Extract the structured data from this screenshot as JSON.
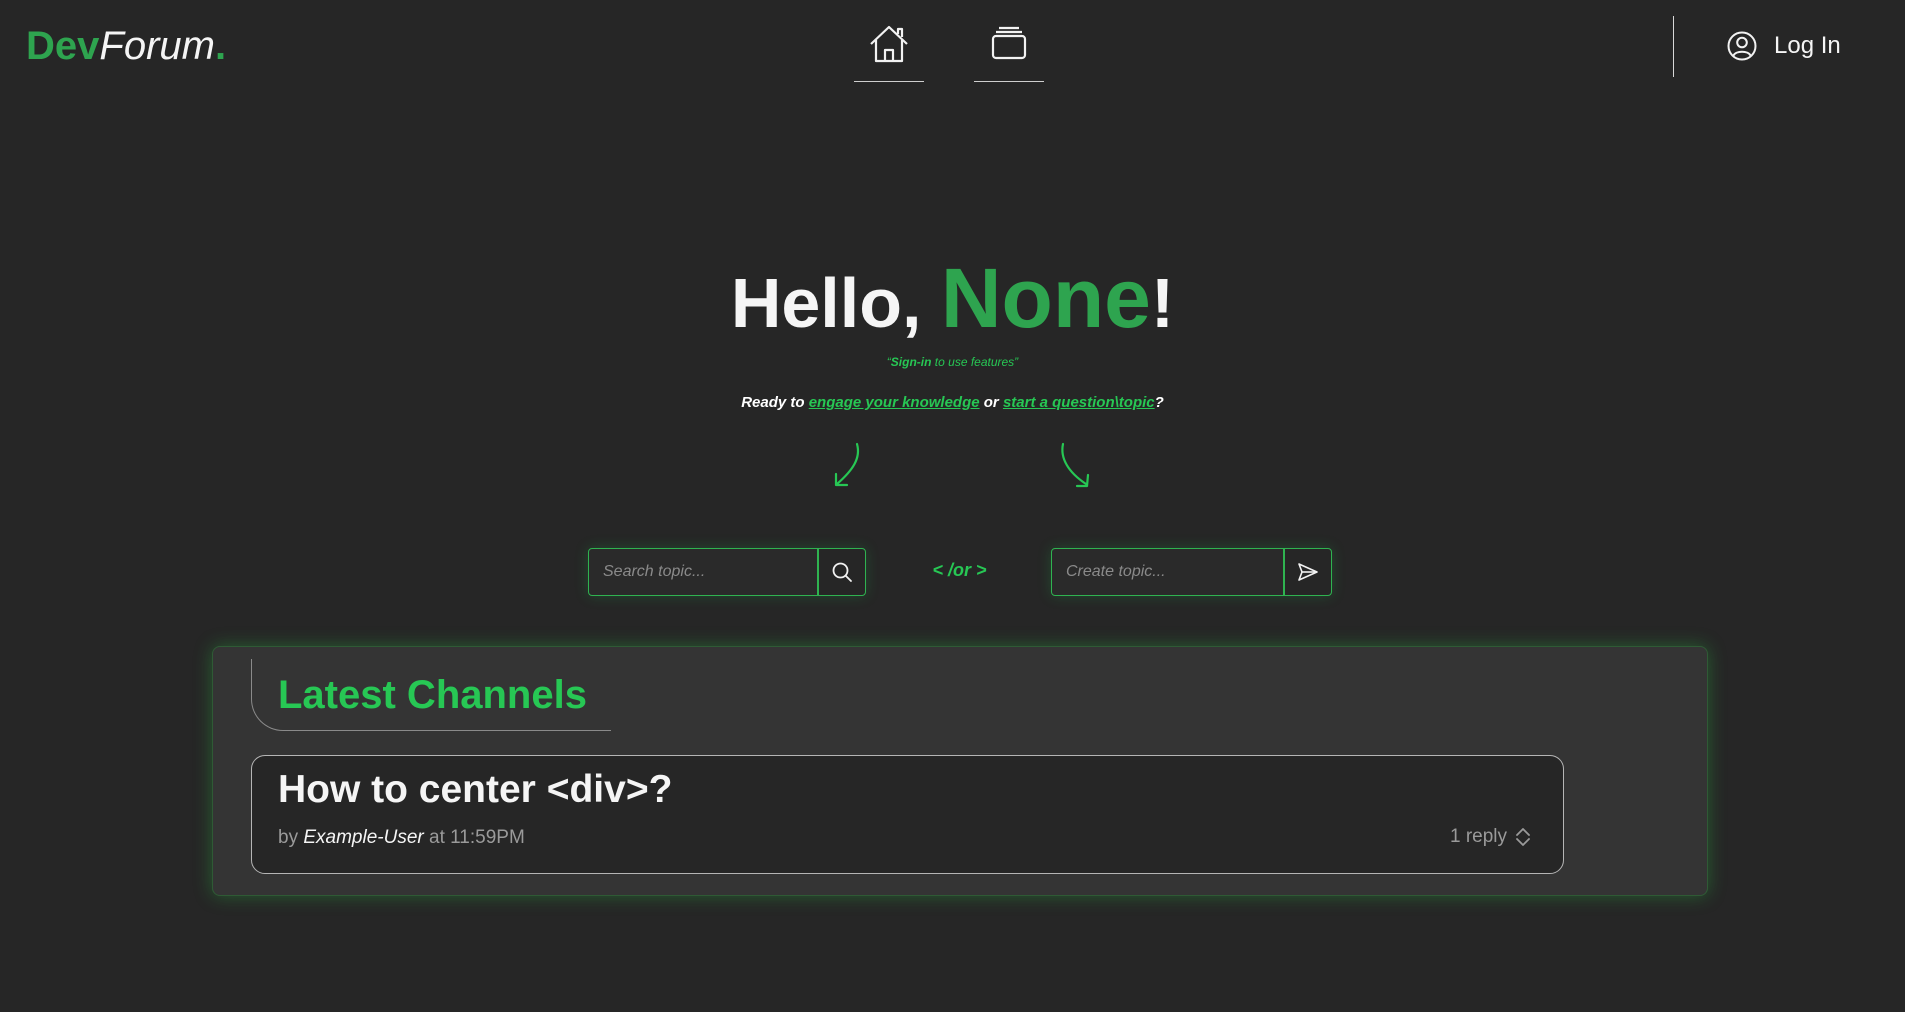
{
  "nav": {
    "logo_dev": "Dev",
    "logo_forum": "Forum",
    "logo_dot": ".",
    "tabs": [
      {
        "icon": "home-icon"
      },
      {
        "icon": "channels-icon"
      }
    ],
    "login_label": "Log In",
    "login_icon": "user-circle-icon"
  },
  "hero": {
    "greeting": "Hello, ",
    "username": "None",
    "exclaim": "!",
    "hint_open": "“",
    "hint_bold": "Sign-in",
    "hint_rest": " to use features”",
    "ready_prefix": "Ready to ",
    "link_engage": "engage your knowledge",
    "ready_or": " or ",
    "link_start": "start a question\\topic",
    "ready_suffix": "?"
  },
  "search": {
    "placeholder": "Search topic...",
    "button_icon": "search-icon"
  },
  "separator": "< /or >",
  "create": {
    "placeholder": "Create topic...",
    "button_icon": "send-icon"
  },
  "channels": {
    "heading": "Latest Channels",
    "items": [
      {
        "title": "How to center <div>?",
        "by": "by ",
        "author": "Example-User",
        "at": " at 11:59PM",
        "replies": "1 reply"
      }
    ]
  },
  "colors": {
    "accent": "#2ea44f",
    "accent_bright": "#27c754",
    "background": "#262626",
    "panel": "#343434"
  }
}
